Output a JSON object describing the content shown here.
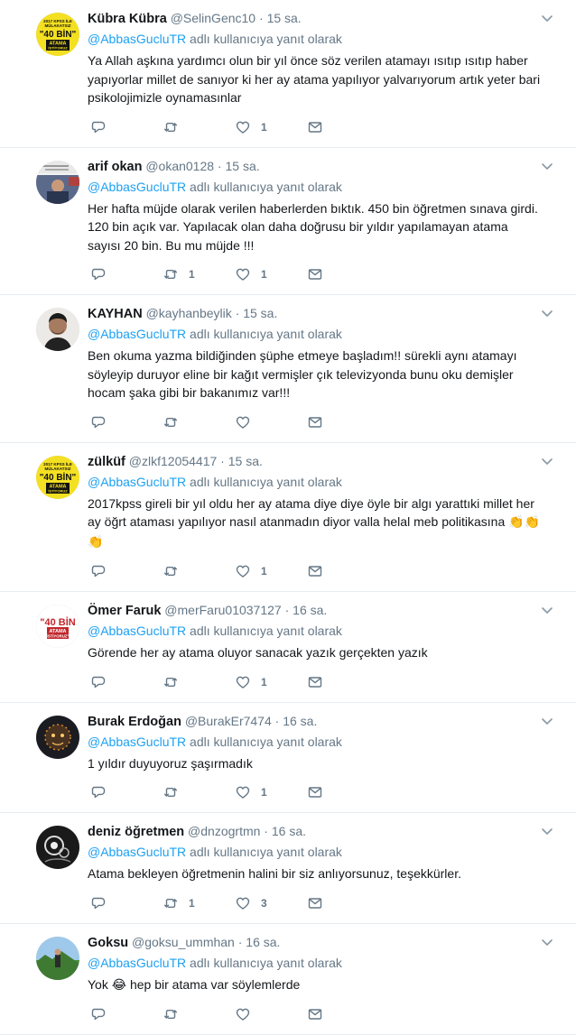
{
  "tweets": [
    {
      "fullname": "Kübra Kübra",
      "username": "@SelinGenc10",
      "time": "15 sa.",
      "reply_mention": "@AbbasGucluTR",
      "reply_suffix": " adlı kullanıcıya yanıt olarak",
      "text": "Ya Allah aşkına yardımcı olun bir yıl önce söz verilen atamayı ısıtıp ısıtıp haber yapıyorlar millet de sanıyor ki her ay atama yapılıyor yalvarıyorum artık yeter bari psikolojimizle oynamasınlar",
      "retweets": "",
      "likes": "1",
      "avatar": "poster-yellow",
      "avatar_lines": [
        "2017 KPSS İLE",
        "MÜLAKATSIZ",
        "\"40 BİN\"",
        "ATAMA",
        "İSTİYORUZ"
      ]
    },
    {
      "fullname": "arif okan",
      "username": "@okan0128",
      "time": "15 sa.",
      "reply_mention": "@AbbasGucluTR",
      "reply_suffix": " adlı kullanıcıya yanıt olarak",
      "text": "Her hafta müjde olarak verilen haberlerden bıktık. 450 bin öğretmen sınava girdi. 120 bin açık var. Yapılacak olan daha doğrusu bir yıldır yapılamayan atama sayısı 20 bin. Bu mu müjde !!!",
      "retweets": "1",
      "likes": "1",
      "avatar": "photo-news"
    },
    {
      "fullname": "KAYHAN",
      "username": "@kayhanbeylik",
      "time": "15 sa.",
      "reply_mention": "@AbbasGucluTR",
      "reply_suffix": " adlı kullanıcıya yanıt olarak",
      "text": "Ben okuma yazma bildiğinden şüphe etmeye başladım!!  sürekli aynı atamayı söyleyip duruyor eline bir kağıt vermişler çık televizyonda bunu oku demişler hocam şaka gibi bir bakanımız var!!!",
      "retweets": "",
      "likes": "",
      "avatar": "photo-man"
    },
    {
      "fullname": "zülküf",
      "username": "@zlkf12054417",
      "time": "15 sa.",
      "reply_mention": "@AbbasGucluTR",
      "reply_suffix": " adlı kullanıcıya yanıt olarak",
      "text": "2017kpss gireli bir yıl oldu her ay atama diye diye öyle bir algı yarattıki millet her ay öğrt ataması yapılıyor nasıl atanmadın diyor valla helal meb politikasına ",
      "emoji": "👏👏👏",
      "retweets": "",
      "likes": "1",
      "avatar": "poster-yellow",
      "avatar_lines": [
        "2017 KPSS İLE",
        "MÜLAKATSIZ",
        "\"40 BİN\"",
        "ATAMA",
        "İSTİYORUZ"
      ]
    },
    {
      "fullname": "Ömer Faruk",
      "username": "@merFaru01037127",
      "time": "16 sa.",
      "reply_mention": "@AbbasGucluTR",
      "reply_suffix": " adlı kullanıcıya yanıt olarak",
      "text": "Görende her ay atama oluyor sanacak yazık gerçekten yazık",
      "retweets": "",
      "likes": "1",
      "avatar": "poster-white",
      "avatar_lines": [
        "\"40 BİN",
        "ATAMA",
        "İSTİYORUZ\""
      ]
    },
    {
      "fullname": "Burak Erdoğan",
      "username": "@BurakEr7474",
      "time": "16 sa.",
      "reply_mention": "@AbbasGucluTR",
      "reply_suffix": " adlı kullanıcıya yanıt olarak",
      "text": "1 yıldır duyuyoruz şaşırmadık",
      "retweets": "",
      "likes": "1",
      "avatar": "photo-dark"
    },
    {
      "fullname": "deniz öğretmen",
      "username": "@dnzogrtmn",
      "time": "16 sa.",
      "reply_mention": "@AbbasGucluTR",
      "reply_suffix": " adlı kullanıcıya yanıt olarak",
      "text": "Atama bekleyen öğretmenin halini bir siz anlıyorsunuz, teşekkürler.",
      "retweets": "1",
      "likes": "3",
      "avatar": "photo-bw"
    },
    {
      "fullname": "Goksu",
      "username": "@goksu_ummhan",
      "time": "16 sa.",
      "reply_mention": "@AbbasGucluTR",
      "reply_suffix": " adlı kullanıcıya yanıt olarak",
      "text_before_emoji": "Yok ",
      "emoji": "😂",
      "text": " hep bir atama var söylemlerde",
      "retweets": "",
      "likes": "",
      "avatar": "photo-landscape"
    }
  ],
  "colors": {
    "link": "#1da1f2",
    "secondary": "#657786",
    "border": "#e6ecf0",
    "text": "#14171a"
  },
  "icons": {
    "reply": "reply-icon",
    "retweet": "retweet-icon",
    "like": "heart-icon",
    "dm": "envelope-icon",
    "more": "chevron-down-icon"
  }
}
